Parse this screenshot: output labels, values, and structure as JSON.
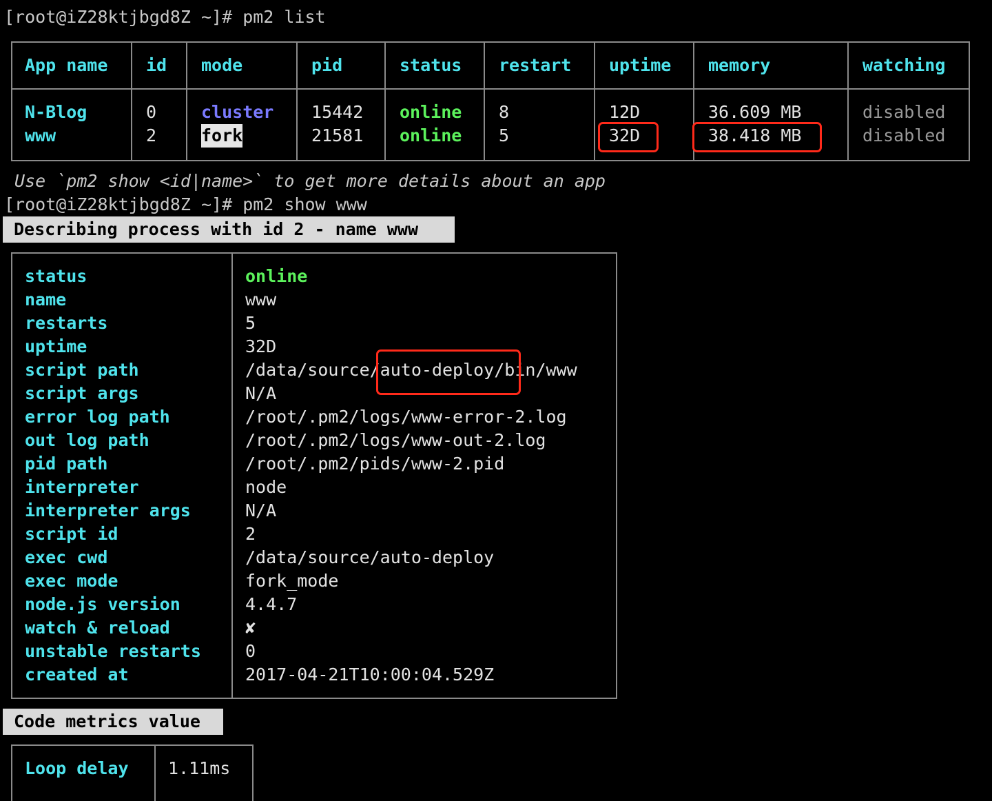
{
  "terminal": {
    "prompt": "[root@iZ28ktjbgd8Z ~]#",
    "cmd1": "pm2 list",
    "cmd2": "pm2 show www",
    "hint": " Use `pm2 show <id|name>` to get more details about an app"
  },
  "list_table": {
    "headers": [
      "App name",
      "id",
      "mode",
      "pid",
      "status",
      "restart",
      "uptime",
      "memory",
      "watching"
    ],
    "rows": [
      {
        "name": "N-Blog",
        "id": "0",
        "mode": "cluster",
        "pid": "15442",
        "status": "online",
        "restart": "8",
        "uptime": "12D",
        "memory": "36.609 MB",
        "watching": "disabled"
      },
      {
        "name": "www",
        "id": "2",
        "mode": "fork",
        "pid": "21581",
        "status": "online",
        "restart": "5",
        "uptime": "32D",
        "memory": "38.418 MB",
        "watching": "disabled"
      }
    ]
  },
  "describe": {
    "banner": "Describing process with id 2 - name www",
    "rows": [
      {
        "key": "status",
        "value": "online"
      },
      {
        "key": "name",
        "value": "www"
      },
      {
        "key": "restarts",
        "value": "5"
      },
      {
        "key": "uptime",
        "value": "32D"
      },
      {
        "key": "script path",
        "value": "/data/source/auto-deploy/bin/www"
      },
      {
        "key": "script args",
        "value": "N/A"
      },
      {
        "key": "error log path",
        "value": "/root/.pm2/logs/www-error-2.log"
      },
      {
        "key": "out log path",
        "value": "/root/.pm2/logs/www-out-2.log"
      },
      {
        "key": "pid path",
        "value": "/root/.pm2/pids/www-2.pid"
      },
      {
        "key": "interpreter",
        "value": "node"
      },
      {
        "key": "interpreter args",
        "value": "N/A"
      },
      {
        "key": "script id",
        "value": "2"
      },
      {
        "key": "exec cwd",
        "value": "/data/source/auto-deploy"
      },
      {
        "key": "exec mode",
        "value": "fork_mode"
      },
      {
        "key": "node.js version",
        "value": "4.4.7"
      },
      {
        "key": "watch & reload",
        "value": "✘"
      },
      {
        "key": "unstable restarts",
        "value": "0"
      },
      {
        "key": "created at",
        "value": "2017-04-21T10:00:04.529Z"
      }
    ]
  },
  "metrics": {
    "banner": "Code metrics value",
    "rows": [
      {
        "key": "Loop delay",
        "value": "1.11ms"
      }
    ]
  },
  "colors": {
    "header_cyan": "#4fe3ec",
    "online_green": "#5cf25c",
    "cluster_blue": "#7a7aff",
    "highlight_red": "#ff2a1a"
  }
}
